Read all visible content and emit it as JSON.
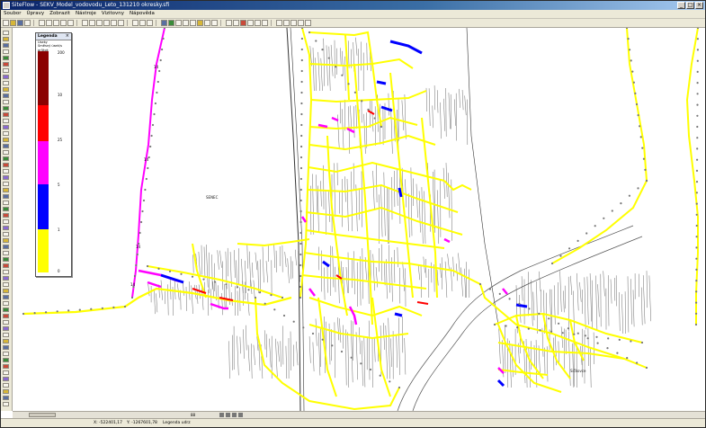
{
  "window": {
    "title": "SiteFlow - SEKV_Model_vodovodu_Leto_131210 okresky.sfi"
  },
  "menubar": {
    "items": [
      "Soubor",
      "Úpravy",
      "Zobrazit",
      "Nástroje",
      "Vizitovny",
      "Nápověda"
    ]
  },
  "legend": {
    "title": "Legenda",
    "close_glyph": "×",
    "subtitle": "Úseky\nSměsný úsek/s průtok",
    "ticks": [
      "200",
      "10",
      "25",
      "5",
      "1",
      "0"
    ],
    "colors": [
      "#8b0000",
      "#ff0000",
      "#ff00ff",
      "#0000ff",
      "#ffff00"
    ]
  },
  "map": {
    "area_label": "SENEC",
    "right_label": "Sičkovce",
    "pipe_label": "14",
    "colors": {
      "pipe_yellow": "#ffff00",
      "pipe_magenta": "#ff00ff",
      "pipe_blue": "#0000ff",
      "pipe_red": "#ff0000",
      "cadastre_lines": "#444444",
      "node_fill": "#777777"
    }
  },
  "scrollbar": {
    "zoom_value": "88"
  },
  "statusbar": {
    "x_coord": "X: -522401,17",
    "y_coord": "Y: -1267601,78",
    "layer": "Legenda udrz"
  }
}
